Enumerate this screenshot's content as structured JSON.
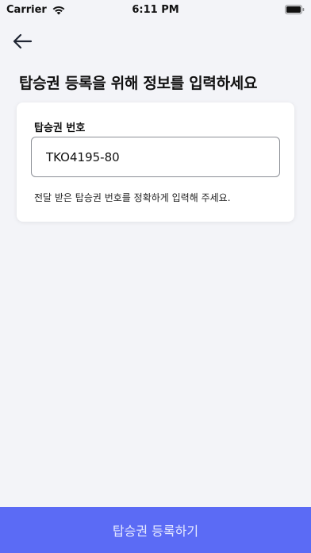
{
  "status_bar": {
    "carrier": "Carrier",
    "time": "6:11 PM",
    "wifi_icon": "wifi-icon",
    "battery_icon": "battery-icon"
  },
  "header": {
    "back_icon": "arrow-left-icon",
    "title": "탑승권 등록을 위해 정보를 입력하세요"
  },
  "form": {
    "label": "탑승권 번호",
    "value": "TKO4195-80",
    "helper": "전달 받은 탑승권 번호를 정확하게 입력해 주세요."
  },
  "footer": {
    "submit_label": "탑승권 등록하기"
  },
  "colors": {
    "background": "#f3f4f8",
    "accent": "#5b6bf5",
    "card": "#ffffff"
  }
}
